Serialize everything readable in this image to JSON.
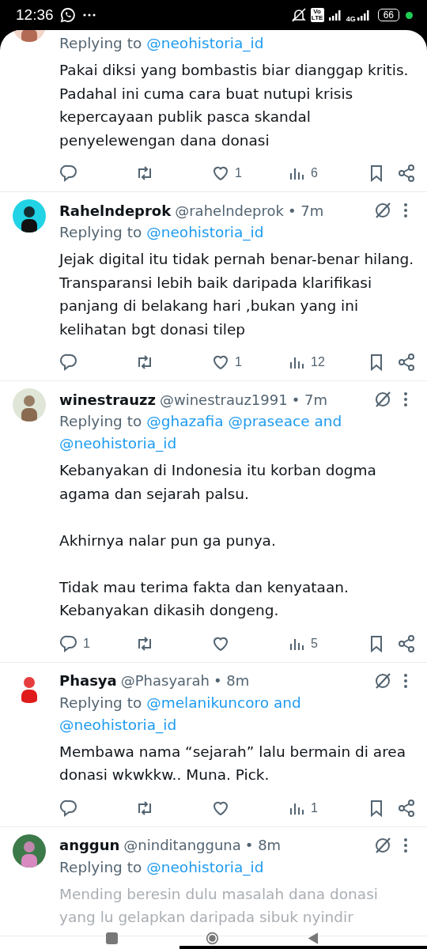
{
  "status_bar": {
    "time": "12:36",
    "volte": "Vo LTE",
    "network": "4G",
    "battery": "66"
  },
  "tweets": [
    {
      "replying_prefix": "Replying to",
      "replying_to": [
        "@neohistoria_id"
      ],
      "body": [
        "Pakai diksi yang bombastis biar dianggap kritis. Padahal ini cuma cara buat nutupi krisis kepercayaan publik pasca skandal penyelewengan dana donasi"
      ],
      "faded": false,
      "actions": [
        {
          "kind": "reply"
        },
        {
          "kind": "retweet"
        },
        {
          "kind": "like",
          "count": "1"
        },
        {
          "kind": "views",
          "count": "6"
        },
        {
          "kind": "bookmark"
        },
        {
          "kind": "share"
        }
      ]
    },
    {
      "name": "Rahelndeprok",
      "handle": "@rahelndeprok",
      "time": "• 7m",
      "replying_prefix": "Replying to",
      "replying_to": [
        "@neohistoria_id"
      ],
      "body": [
        "Jejak digital itu tidak pernah benar-benar hilang. Transparansi lebih baik daripada klarifikasi panjang di belakang hari ,bukan yang ini kelihatan bgt donasi tilep"
      ],
      "faded": false,
      "actions": [
        {
          "kind": "reply"
        },
        {
          "kind": "retweet"
        },
        {
          "kind": "like",
          "count": "1"
        },
        {
          "kind": "views",
          "count": "12"
        },
        {
          "kind": "bookmark"
        },
        {
          "kind": "share"
        }
      ]
    },
    {
      "name": "winestrauzz",
      "handle": "@winestrauz1991",
      "time": "• 7m",
      "replying_prefix": "Replying to",
      "replying_to": [
        "@ghazafia",
        "@praseace",
        "and",
        "@neohistoria_id"
      ],
      "body": [
        "Kebanyakan di Indonesia itu korban dogma agama dan sejarah palsu.",
        "Akhirnya nalar pun ga punya.",
        "Tidak mau terima fakta dan kenyataan. Kebanyakan dikasih dongeng."
      ],
      "faded": false,
      "actions": [
        {
          "kind": "reply",
          "count": "1"
        },
        {
          "kind": "retweet"
        },
        {
          "kind": "like"
        },
        {
          "kind": "views",
          "count": "5"
        },
        {
          "kind": "bookmark"
        },
        {
          "kind": "share"
        }
      ]
    },
    {
      "name": "Phasya",
      "handle": "@Phasyarah",
      "time": "• 8m",
      "replying_prefix": "Replying to",
      "replying_to": [
        "@melanikuncoro",
        "and",
        "@neohistoria_id"
      ],
      "body": [
        "Membawa nama “sejarah” lalu bermain di area donasi wkwkkw.. Muna. Pick."
      ],
      "faded": false,
      "actions": [
        {
          "kind": "reply"
        },
        {
          "kind": "retweet"
        },
        {
          "kind": "like"
        },
        {
          "kind": "views",
          "count": "1"
        },
        {
          "kind": "bookmark"
        },
        {
          "kind": "share"
        }
      ]
    },
    {
      "name": "anggun",
      "handle": "@ninditangguna",
      "time": "• 8m",
      "replying_prefix": "Replying to",
      "replying_to": [
        "@neohistoria_id"
      ],
      "body": [
        "Mending beresin dulu masalah dana donasi yang lu gelapkan daripada sibuk nyindir"
      ],
      "faded": true
    }
  ]
}
